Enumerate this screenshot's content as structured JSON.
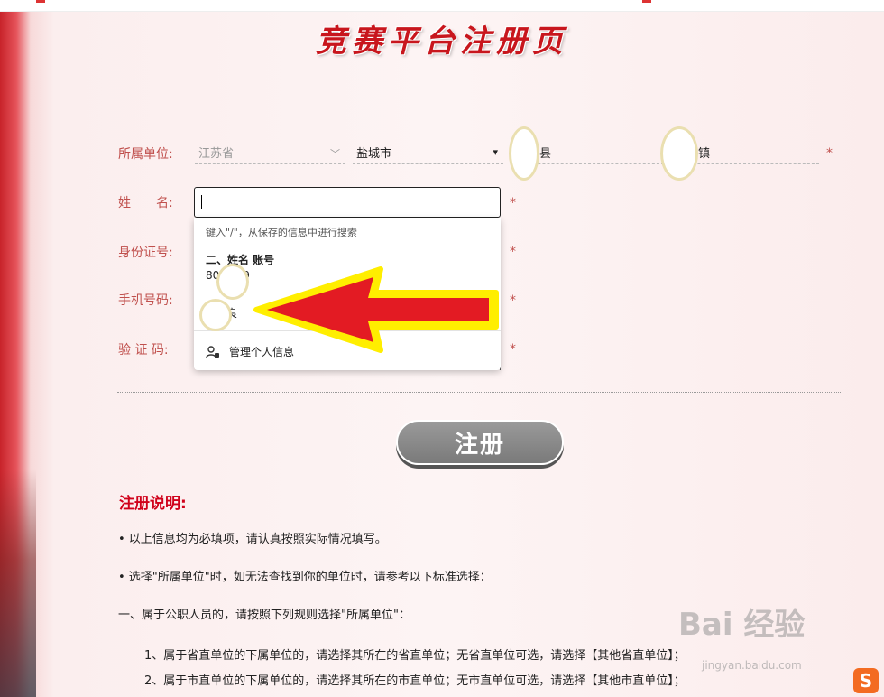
{
  "page_title": "竞赛平台注册页",
  "form": {
    "unit_label": "所属单位:",
    "province": "江苏省",
    "city": "盐城市",
    "county_suffix": "县",
    "town_suffix": "镇",
    "name_label": "姓　　名:",
    "id_label": "身份证号:",
    "phone_label": "手机号码:",
    "captcha_label": "验 证 码:",
    "required_mark": "*"
  },
  "autofill": {
    "hint": "键入\"/\"，从保存的信息中进行搜索",
    "entry_title": "二、姓名 账号",
    "entry_number_start": "80",
    "entry_number_end": "9",
    "entry_name": "良",
    "manage_label": "管理个人信息"
  },
  "register_button": "注册",
  "notes": {
    "title": "注册说明:",
    "line1": "• 以上信息均为必填项，请认真按照实际情况填写。",
    "line2": "• 选择\"所属单位\"时，如无法查找到你的单位时，请参考以下标准选择：",
    "line3": "一、属于公职人员的，请按照下列规则选择\"所属单位\"：",
    "line4": "1、属于省直单位的下属单位的，请选择其所在的省直单位；无省直单位可选，请选择【其他省直单位】；",
    "line5": "2、属于市直单位的下属单位的，请选择其所在的市直单位；无市直单位可选，请选择【其他市直单位】；"
  },
  "watermark": {
    "brand": "Bai 经验",
    "url": "jingyan.baidu.com"
  },
  "colors": {
    "accent": "#c8161d",
    "label": "#c0504d",
    "arrow_fill": "#e31b23",
    "arrow_outline": "#ffee00"
  }
}
